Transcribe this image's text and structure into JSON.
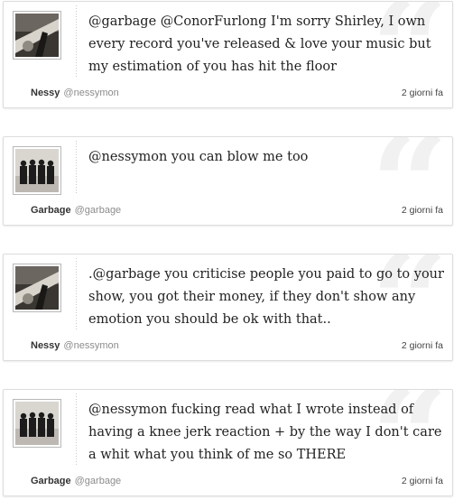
{
  "tweets": [
    {
      "author": "Nessy",
      "handle": "@nessymon",
      "text": "@garbage @ConorFurlong I'm sorry Shirley, I own every record you've released & love your music but my estimation of you has hit the floor",
      "time": "2 giorni fa",
      "avatar_icon": "nessy-avatar-image"
    },
    {
      "author": "Garbage",
      "handle": "@garbage",
      "text": "@nessymon you can blow me too",
      "time": "2 giorni fa",
      "avatar_icon": "garbage-band-avatar-image"
    },
    {
      "author": "Nessy",
      "handle": "@nessymon",
      "text": ".@garbage you criticise people you paid to go to your show, you got their money, if they don't show any emotion you should be ok with that..",
      "time": "2 giorni fa",
      "avatar_icon": "nessy-avatar-image"
    },
    {
      "author": "Garbage",
      "handle": "@garbage",
      "text": "@nessymon fucking read what I wrote instead of having a knee jerk reaction + by the way I don't care a whit what you think of me so THERE",
      "time": "2 giorni fa",
      "avatar_icon": "garbage-band-avatar-image"
    }
  ],
  "decor": {
    "quote_mark": "“",
    "quote_color": "#f1f1f1",
    "border_color": "#dcdcdc"
  }
}
